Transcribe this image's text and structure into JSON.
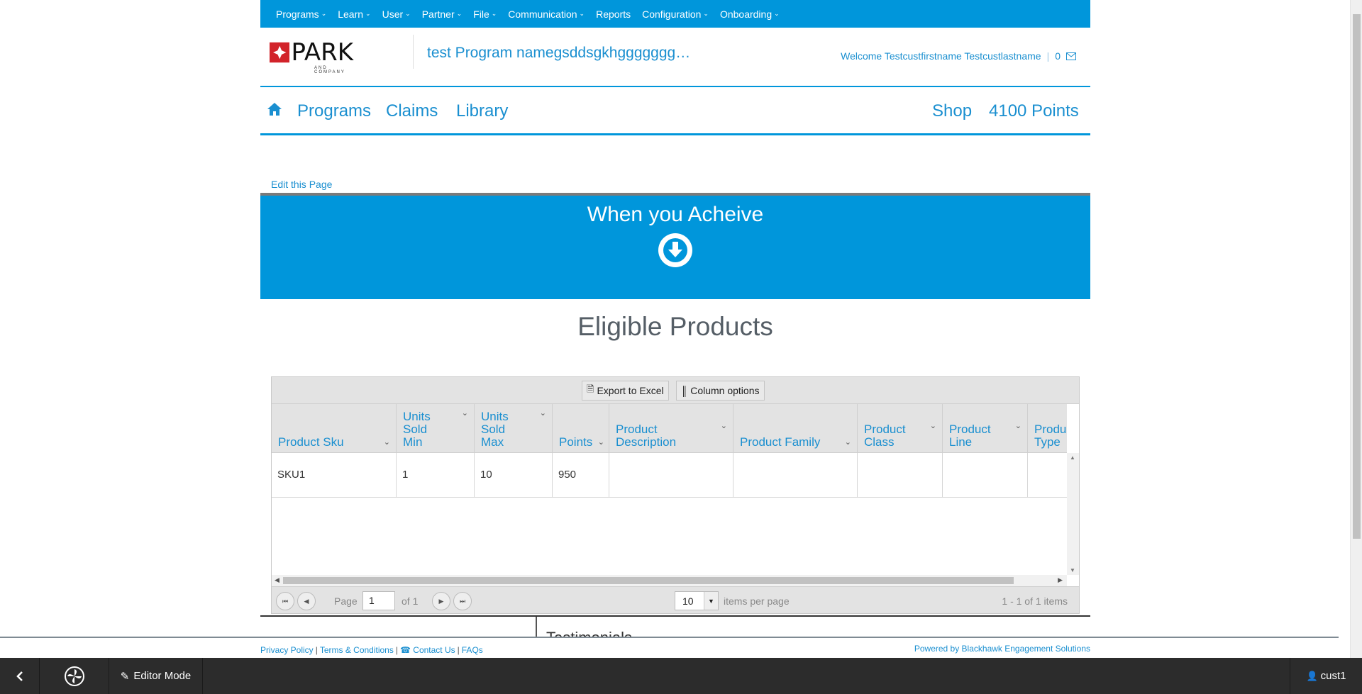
{
  "admin_nav": {
    "items": [
      {
        "label": "Programs",
        "has_menu": true
      },
      {
        "label": "Learn",
        "has_menu": true
      },
      {
        "label": "User",
        "has_menu": true
      },
      {
        "label": "Partner",
        "has_menu": true
      },
      {
        "label": "File",
        "has_menu": true
      },
      {
        "label": "Communication",
        "has_menu": true
      },
      {
        "label": "Reports",
        "has_menu": false
      },
      {
        "label": "Configuration",
        "has_menu": true
      },
      {
        "label": "Onboarding",
        "has_menu": true
      }
    ]
  },
  "header": {
    "logo_text": "PARK",
    "logo_subtext": "AND COMPANY",
    "program_name": "test Program namegsddsgkhggggggg…",
    "welcome": "Welcome Testcustfirstname Testcustlastname",
    "message_count": "0"
  },
  "site_nav": {
    "left": [
      "Programs",
      "Claims",
      "Library"
    ],
    "shop": "Shop",
    "points": "4100 Points"
  },
  "edit_link": "Edit this Page",
  "banner": {
    "title": "When you Acheive"
  },
  "section_title": "Eligible Products",
  "grid": {
    "toolbar": {
      "export": "Export to Excel",
      "columns": "Column options"
    },
    "columns": [
      {
        "label": "Product Sku"
      },
      {
        "label": "Units\nSold\nMin"
      },
      {
        "label": "Units\nSold\nMax"
      },
      {
        "label": "Points"
      },
      {
        "label": "Product\nDescription"
      },
      {
        "label": "Product Family"
      },
      {
        "label": "Product\nClass"
      },
      {
        "label": "Product\nLine"
      },
      {
        "label": "Produ\nType"
      }
    ],
    "rows": [
      [
        "SKU1",
        "1",
        "10",
        "950",
        "",
        "",
        "",
        "",
        ""
      ]
    ],
    "pager": {
      "page_label": "Page",
      "page_value": "1",
      "of_label": "of 1",
      "page_size": "10",
      "per_page_label": "items per page",
      "summary": "1 - 1 of 1 items"
    }
  },
  "below_text": "Testimonials",
  "footer": {
    "links": [
      "Privacy Policy",
      "Terms & Conditions",
      "Contact Us",
      "FAQs"
    ],
    "powered_by": "Powered by Blackhawk Engagement Solutions"
  },
  "editor_bar": {
    "mode": "Editor Mode",
    "user": "cust1"
  },
  "colors": {
    "brand_blue": "#0096db",
    "link_blue": "#1a8fd0",
    "dark_bar": "#2c2c2c",
    "logo_red": "#d2232a"
  }
}
